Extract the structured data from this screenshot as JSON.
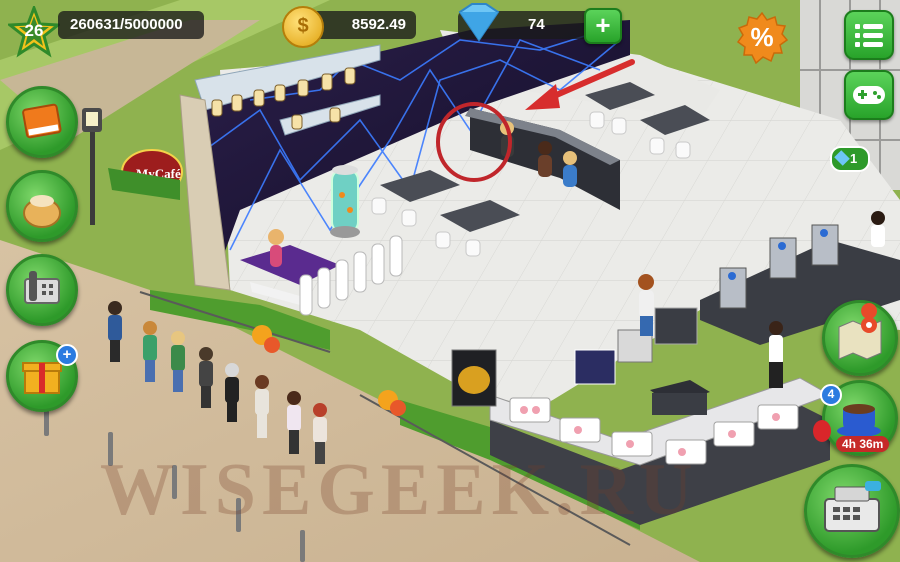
{
  "hud": {
    "level": "26",
    "xp": "260631/5000000",
    "coins": "8592.49",
    "gems": "74",
    "add_label": "+",
    "sale_label": "%",
    "quest_badge": "1",
    "order_badge": "4",
    "order_timer": "4h 36m",
    "gift_plus": "+"
  },
  "scene": {
    "cafe_sign": "MyCafé",
    "watermark": "WISEGEEK.RU"
  },
  "colors": {
    "accent_green": "#2e9a2a",
    "star_yellow": "#f2c21b",
    "highlight_red": "#c0262b",
    "sale_orange": "#f08a1c"
  }
}
